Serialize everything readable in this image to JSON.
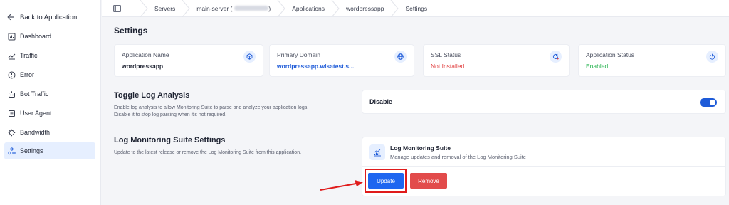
{
  "sidebar": {
    "back_label": "Back to Application",
    "items": [
      {
        "label": "Dashboard",
        "icon": "chart-bar-icon"
      },
      {
        "label": "Traffic",
        "icon": "traffic-icon"
      },
      {
        "label": "Error",
        "icon": "error-icon"
      },
      {
        "label": "Bot Traffic",
        "icon": "bot-icon"
      },
      {
        "label": "User Agent",
        "icon": "user-agent-icon"
      },
      {
        "label": "Bandwidth",
        "icon": "bandwidth-icon"
      },
      {
        "label": "Settings",
        "icon": "settings-icon",
        "active": true
      }
    ]
  },
  "breadcrumb": {
    "items": [
      "Servers",
      "main-server (",
      "Applications",
      "wordpressapp",
      "Settings"
    ],
    "server_suffix": ")"
  },
  "settings": {
    "title": "Settings",
    "cards": [
      {
        "label": "Application Name",
        "value": "wordpressapp",
        "icon": "cube-icon"
      },
      {
        "label": "Primary Domain",
        "value": "wordpressapp.wlsatest.s...",
        "icon": "globe-icon"
      },
      {
        "label": "SSL Status",
        "value": "Not Installed",
        "icon": "ssl-refresh-icon"
      },
      {
        "label": "Application Status",
        "value": "Enabled",
        "icon": "power-icon"
      }
    ]
  },
  "toggle_log": {
    "title": "Toggle Log Analysis",
    "desc_line1": "Enable log analysis to allow Monitoring Suite to parse and analyze your application logs.",
    "desc_line2": "Disable it to stop log parsing when it's not required.",
    "switch_label": "Disable",
    "switch_on": true
  },
  "lms": {
    "title": "Log Monitoring Suite Settings",
    "desc": "Update to the latest release or remove the Log Monitoring Suite from this application.",
    "card_title": "Log Monitoring Suite",
    "card_sub": "Manage updates and removal of the Log Monitoring Suite",
    "update_label": "Update",
    "remove_label": "Remove"
  },
  "colors": {
    "accent": "#1e66f0",
    "link": "#1e5bd8",
    "danger": "#e24b4b",
    "success": "#22b24c",
    "error_text": "#e03c3c",
    "highlight": "#e01b1b"
  }
}
